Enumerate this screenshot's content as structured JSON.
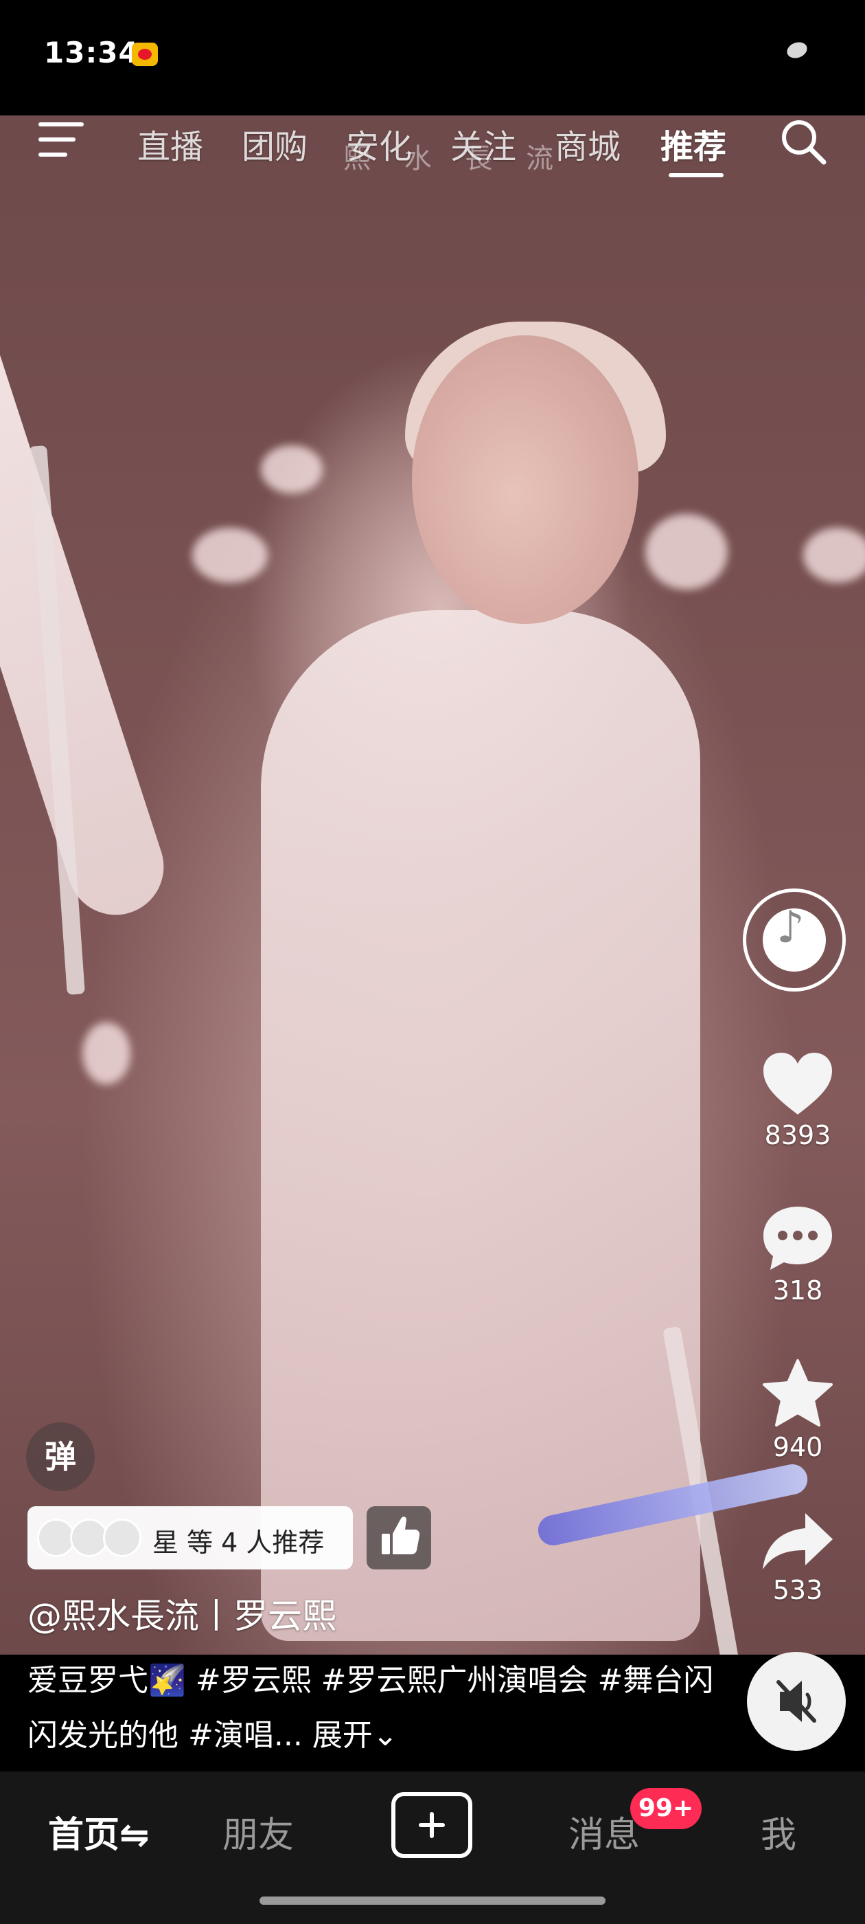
{
  "status_bar": {
    "time": "13:34",
    "notification_icon": "weibo-icon"
  },
  "top_nav": {
    "tabs": [
      {
        "label": "直播"
      },
      {
        "label": "团购"
      },
      {
        "label": "安化"
      },
      {
        "label": "关注"
      },
      {
        "label": "商城"
      },
      {
        "label": "推荐"
      }
    ],
    "active_tab": "推荐",
    "left_icon": "menu-icon",
    "right_icon": "search-icon"
  },
  "video": {
    "watermark": "熙 水 長 流"
  },
  "actions": {
    "likes": "8393",
    "comments": "318",
    "favorites": "940",
    "shares": "533"
  },
  "danmaku_label": "弹",
  "recommend": {
    "text": "星 等 4 人推荐"
  },
  "author": "@熙水長流丨罗云熙",
  "caption": {
    "text": "爱豆罗弋🌠 #罗云熙 #罗云熙广州演唱会 #舞台闪闪发光的他 #演唱...",
    "expand": "展开⌄"
  },
  "bottom_nav": {
    "home": "首页⇋",
    "friends": "朋友",
    "messages": "消息",
    "me": "我",
    "badge": "99+"
  },
  "colors": {
    "badge": "#fe2c55",
    "bottom_nav_bg": "#171717",
    "accent": "#ffffff"
  }
}
